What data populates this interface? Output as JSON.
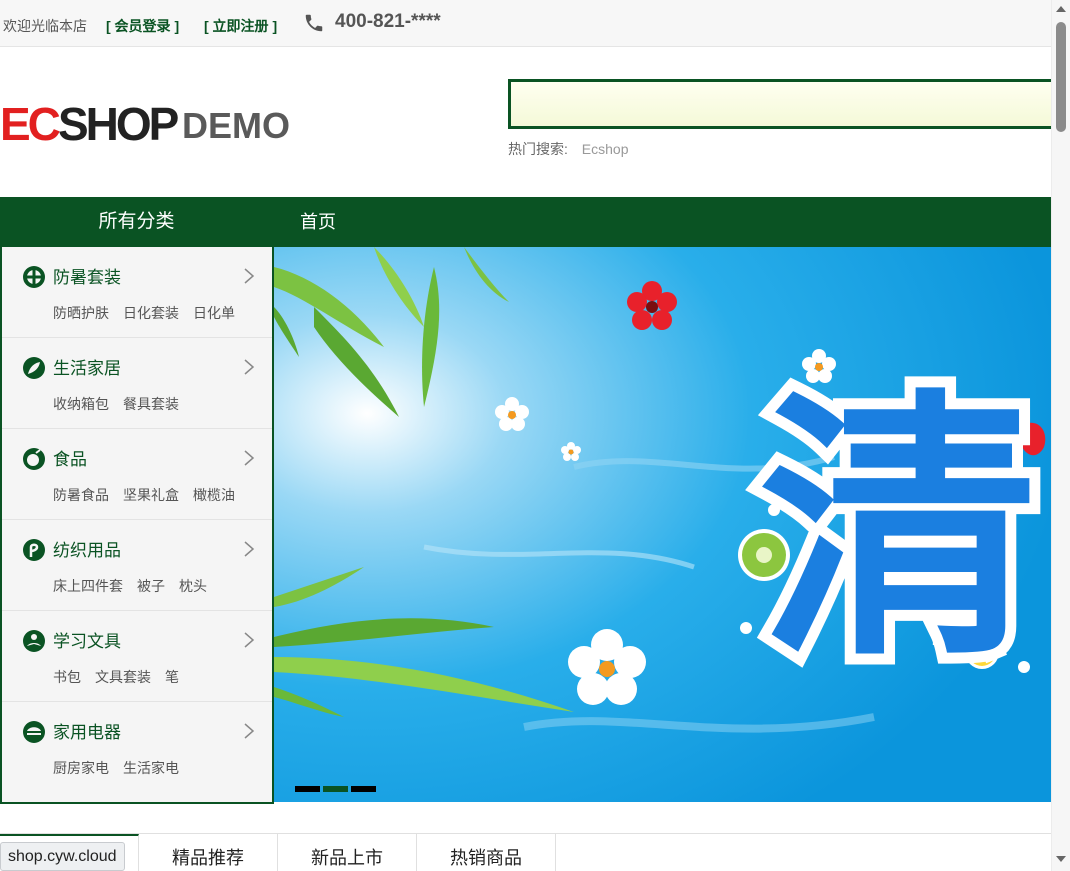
{
  "topbar": {
    "welcome": "欢迎光临本店",
    "login_link": "[ 会员登录 ]",
    "register_link": "[ 立即注册 ]",
    "phone_icon": "phone-icon",
    "phone": "400-821-****"
  },
  "header": {
    "logo_text": "ECSHOP DEMO",
    "search": {
      "value": "",
      "placeholder": ""
    },
    "hot_label": "热门搜索:",
    "hot_words": [
      "Ecshop"
    ]
  },
  "nav": {
    "all_categories": "所有分类",
    "items": [
      "首页"
    ]
  },
  "categories": [
    {
      "name": "防暑套装",
      "icon": "cross-circle-icon",
      "subs": [
        "防晒护肤",
        "日化套装",
        "日化单"
      ]
    },
    {
      "name": "生活家居",
      "icon": "leaf-icon",
      "subs": [
        "收纳箱包",
        "餐具套装"
      ]
    },
    {
      "name": "食品",
      "icon": "food-icon",
      "subs": [
        "防暑食品",
        "坚果礼盒",
        "橄榄油"
      ]
    },
    {
      "name": "纺织用品",
      "icon": "textile-icon",
      "subs": [
        "床上四件套",
        "被子",
        "枕头"
      ]
    },
    {
      "name": "学习文具",
      "icon": "study-icon",
      "subs": [
        "书包",
        "文具套装",
        "笔"
      ]
    },
    {
      "name": "家用电器",
      "icon": "appliance-icon",
      "subs": [
        "厨房家电",
        "生活家电"
      ]
    }
  ],
  "banner": {
    "headline_char": "清",
    "slide_count": 3,
    "active_slide": 2
  },
  "tabs": [
    "精品推荐",
    "新品上市",
    "热销商品"
  ],
  "status_url": "shop.cyw.cloud",
  "colors": {
    "brand_green": "#0a5323",
    "banner_sky": "#1aa3e8"
  }
}
